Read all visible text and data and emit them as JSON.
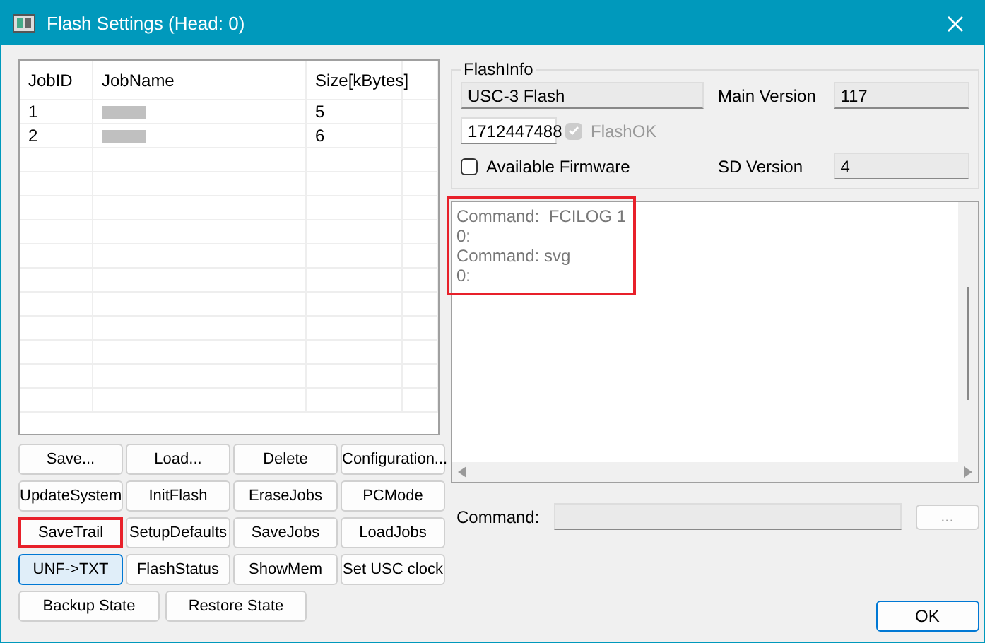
{
  "window": {
    "title": "Flash Settings (Head: 0)"
  },
  "jobs_table": {
    "columns": [
      "JobID",
      "JobName",
      "Size[kBytes]"
    ],
    "rows": [
      {
        "id": "1",
        "size": "5",
        "name_redacted": true
      },
      {
        "id": "2",
        "size": "6",
        "name_redacted": true
      }
    ]
  },
  "buttons": [
    {
      "label": "Save...",
      "focused": false,
      "highlighted": false
    },
    {
      "label": "Load...",
      "focused": false,
      "highlighted": false
    },
    {
      "label": "Delete",
      "focused": false,
      "highlighted": false
    },
    {
      "label": "Configuration...",
      "focused": false,
      "highlighted": false
    },
    {
      "label": "UpdateSystem",
      "focused": false,
      "highlighted": false
    },
    {
      "label": "InitFlash",
      "focused": false,
      "highlighted": false
    },
    {
      "label": "EraseJobs",
      "focused": false,
      "highlighted": false
    },
    {
      "label": "PCMode",
      "focused": false,
      "highlighted": false
    },
    {
      "label": "SaveTrail",
      "focused": false,
      "highlighted": true
    },
    {
      "label": "SetupDefaults",
      "focused": false,
      "highlighted": false
    },
    {
      "label": "SaveJobs",
      "focused": false,
      "highlighted": false
    },
    {
      "label": "LoadJobs",
      "focused": false,
      "highlighted": false
    },
    {
      "label": "UNF->TXT",
      "focused": true,
      "highlighted": false
    },
    {
      "label": "FlashStatus",
      "focused": false,
      "highlighted": false
    },
    {
      "label": "ShowMem",
      "focused": false,
      "highlighted": false
    },
    {
      "label": "Set USC clock",
      "focused": false,
      "highlighted": false
    }
  ],
  "wide_buttons": [
    "Backup State",
    "Restore State"
  ],
  "flash_info": {
    "title": "FlashInfo",
    "device": "USC-3 Flash",
    "serial": "1712447488",
    "flash_ok": {
      "label": "FlashOK",
      "checked": true,
      "disabled": true
    },
    "available_firmware": {
      "label": "Available Firmware",
      "checked": false
    },
    "main_version_label": "Main Version",
    "main_version": "117",
    "sd_version_label": "SD Version",
    "sd_version": "4"
  },
  "log": {
    "highlighted": true,
    "lines": [
      "Command:  FCILOG 1",
      "0:",
      "Command: svg",
      "0:"
    ]
  },
  "command": {
    "label": "Command:",
    "browse_label": "...",
    "browse_disabled": true
  },
  "ok_label": "OK"
}
